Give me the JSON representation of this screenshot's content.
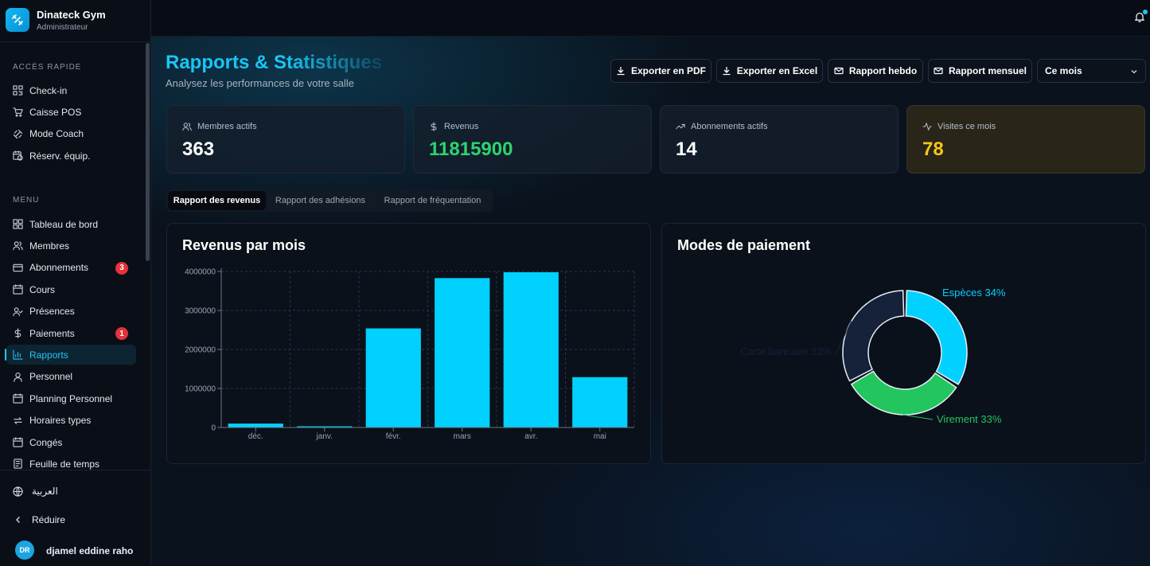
{
  "brand": {
    "name": "Dinateck Gym",
    "role": "Administrateur"
  },
  "sidebar": {
    "quick_title": "ACCÈS RAPIDE",
    "quick_items": [
      {
        "label": "Check-in",
        "icon": "qr-icon"
      },
      {
        "label": "Caisse POS",
        "icon": "cart-icon"
      },
      {
        "label": "Mode Coach",
        "icon": "dumbbell-icon"
      },
      {
        "label": "Réserv. équip.",
        "icon": "calendar-clock-icon"
      }
    ],
    "menu_title": "MENU",
    "menu_items": [
      {
        "label": "Tableau de bord",
        "icon": "dashboard-icon"
      },
      {
        "label": "Membres",
        "icon": "users-icon"
      },
      {
        "label": "Abonnements",
        "icon": "card-icon",
        "badge": "3"
      },
      {
        "label": "Cours",
        "icon": "calendar-icon"
      },
      {
        "label": "Présences",
        "icon": "user-check-icon"
      },
      {
        "label": "Paiements",
        "icon": "dollar-icon",
        "badge": "1"
      },
      {
        "label": "Rapports",
        "icon": "bar-chart-icon",
        "active": true
      },
      {
        "label": "Personnel",
        "icon": "staff-icon"
      },
      {
        "label": "Planning Personnel",
        "icon": "calendar-icon"
      },
      {
        "label": "Horaires types",
        "icon": "repeat-icon"
      },
      {
        "label": "Congés",
        "icon": "calendar-icon"
      },
      {
        "label": "Feuille de temps",
        "icon": "timesheet-icon"
      }
    ],
    "footer": {
      "language": "العربية",
      "collapse": "Réduire",
      "user_initials": "DR",
      "user_name": "djamel eddine raho"
    }
  },
  "header": {
    "title": "Rapports & Statistiques",
    "subtitle": "Analysez les performances de votre salle",
    "buttons": {
      "pdf": "Exporter en PDF",
      "excel": "Exporter en Excel",
      "weekly": "Rapport hebdo",
      "monthly": "Rapport mensuel"
    },
    "period": "Ce mois"
  },
  "stats": [
    {
      "label": "Membres actifs",
      "value": "363",
      "color": "#ffffff",
      "icon": "users-icon"
    },
    {
      "label": "Revenus",
      "value": "11815900",
      "color": "#2dd36f",
      "icon": "dollar-icon"
    },
    {
      "label": "Abonnements actifs",
      "value": "14",
      "color": "#ffffff",
      "icon": "trending-up-icon"
    },
    {
      "label": "Visites ce mois",
      "value": "78",
      "color": "#f5c518",
      "icon": "activity-icon"
    }
  ],
  "tabs": [
    "Rapport des revenus",
    "Rapport des adhésions",
    "Rapport de fréquentation"
  ],
  "panels": {
    "revenue_title": "Revenus par mois",
    "payment_title": "Modes de paiement"
  },
  "colors": {
    "accent": "#22c5f3",
    "bar": "#00d1ff",
    "green": "#22c55e",
    "navy": "#15223a",
    "danger": "#e5323b"
  },
  "chart_data": [
    {
      "type": "bar",
      "categories": [
        "déc.",
        "janv.",
        "févr.",
        "mars",
        "avr.",
        "mai"
      ],
      "values": [
        100000,
        30000,
        2540000,
        3830000,
        3980000,
        1290000
      ],
      "ylim": [
        0,
        4000000
      ],
      "yticks": [
        "0",
        "1000000",
        "2000000",
        "3000000",
        "4000000"
      ],
      "grid": true
    },
    {
      "type": "pie",
      "donut": true,
      "slices": [
        {
          "label": "Espèces 34%",
          "value": 34,
          "color": "#00d1ff"
        },
        {
          "label": "Virement 33%",
          "value": 33,
          "color": "#22c55e"
        },
        {
          "label": "Carte bancaire 33%",
          "value": 33,
          "color": "#15223a"
        }
      ]
    }
  ]
}
